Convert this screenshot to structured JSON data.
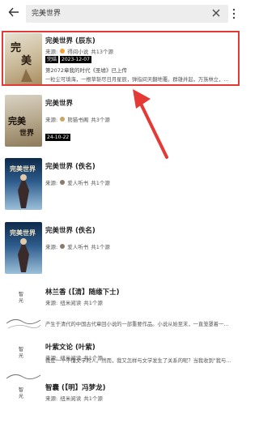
{
  "search": {
    "query": "完美世界"
  },
  "books": [
    {
      "title": "完美世界 (辰东)",
      "source_label": "来源:",
      "source_name": "得间小说",
      "source_count": "共13个源",
      "status": "完结",
      "date": "2023-12-07",
      "latest": "第2072章我的时代《圣墟》已上传",
      "intro": "一粒尘可填海，一根草斩尽日月星辰，弹指间天翻地覆。群雄并起，万族林立，诸圣争..."
    },
    {
      "title": "完美世界",
      "source_label": "来源:",
      "source_name": "熊猫书阁",
      "source_count": "共3个源",
      "date": "24-10-22"
    },
    {
      "title": "完美世界 (佚名)",
      "source_label": "来源:",
      "source_name": "爱人听书",
      "source_count": "共1个源"
    },
    {
      "title": "完美世界 (佚名)",
      "source_label": "来源:",
      "source_name": "爱人听书",
      "source_count": "共1个源"
    },
    {
      "title": "林兰香 (【清】随缘下士)",
      "source_label": "来源:",
      "source_name": "纽米阅读",
      "source_count": "共1个源",
      "intro": "产生于清代的中国古代章回小说的一部重要作品。小说从始至末，一直笼罩着一种人生..."
    },
    {
      "title": "叶紫文论 (叶紫)",
      "source_label": "来源:",
      "source_name": "纽米阅读",
      "source_count": "共1个源",
      "intro": "我是一个不懂文学的人。然而，我又怎样与文学发生了关系的呢？当我收到\"我与文学\"这..."
    },
    {
      "title": "智囊 (【明】冯梦龙)",
      "source_label": "来源:",
      "source_name": "纽米阅读",
      "source_count": "共1个源"
    }
  ],
  "colors": {
    "highlight": "#e53935",
    "accent": "#e53935"
  }
}
